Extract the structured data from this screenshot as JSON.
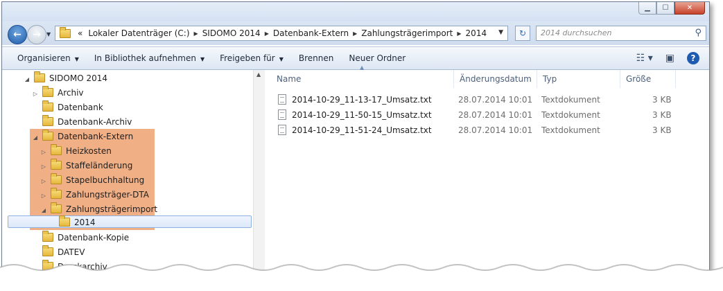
{
  "window": {
    "buttons": {
      "minimize": "▁",
      "maximize": "☐",
      "close": "✕"
    }
  },
  "address": {
    "overflow": "«",
    "breadcrumbs": [
      "Lokaler Datenträger (C:)",
      "SIDOMO 2014",
      "Datenbank-Extern",
      "Zahlungsträgerimport",
      "2014"
    ],
    "search_placeholder": "2014 durchsuchen"
  },
  "toolbar": {
    "organize": "Organisieren",
    "library": "In Bibliothek aufnehmen",
    "share": "Freigeben für",
    "burn": "Brennen",
    "new_folder": "Neuer Ordner",
    "help": "?"
  },
  "tree": {
    "items": [
      {
        "label": "SIDOMO 2014",
        "expander": "◢"
      },
      {
        "label": "Archiv",
        "expander": "▷"
      },
      {
        "label": "Datenbank",
        "expander": ""
      },
      {
        "label": "Datenbank-Archiv",
        "expander": ""
      },
      {
        "label": "Datenbank-Extern",
        "expander": "◢"
      },
      {
        "label": "Heizkosten",
        "expander": "▷"
      },
      {
        "label": "Staffeländerung",
        "expander": "▷"
      },
      {
        "label": "Stapelbuchhaltung",
        "expander": "▷"
      },
      {
        "label": "Zahlungsträger-DTA",
        "expander": "▷"
      },
      {
        "label": "Zahlungsträgerimport",
        "expander": "◢"
      },
      {
        "label": "2014",
        "expander": ""
      },
      {
        "label": "Datenbank-Kopie",
        "expander": ""
      },
      {
        "label": "DATEV",
        "expander": ""
      },
      {
        "label": "Druckarchiv",
        "expander": ""
      }
    ],
    "highlight_color": "#eea170"
  },
  "columns": {
    "name": "Name",
    "date": "Änderungsdatum",
    "type": "Typ",
    "size": "Größe"
  },
  "files": [
    {
      "name": "2014-10-29_11-13-17_Umsatz.txt",
      "date": "28.07.2014 10:01",
      "type": "Textdokument",
      "size": "3 KB"
    },
    {
      "name": "2014-10-29_11-50-15_Umsatz.txt",
      "date": "28.07.2014 10:01",
      "type": "Textdokument",
      "size": "3 KB"
    },
    {
      "name": "2014-10-29_11-51-24_Umsatz.txt",
      "date": "28.07.2014 10:01",
      "type": "Textdokument",
      "size": "3 KB"
    }
  ]
}
